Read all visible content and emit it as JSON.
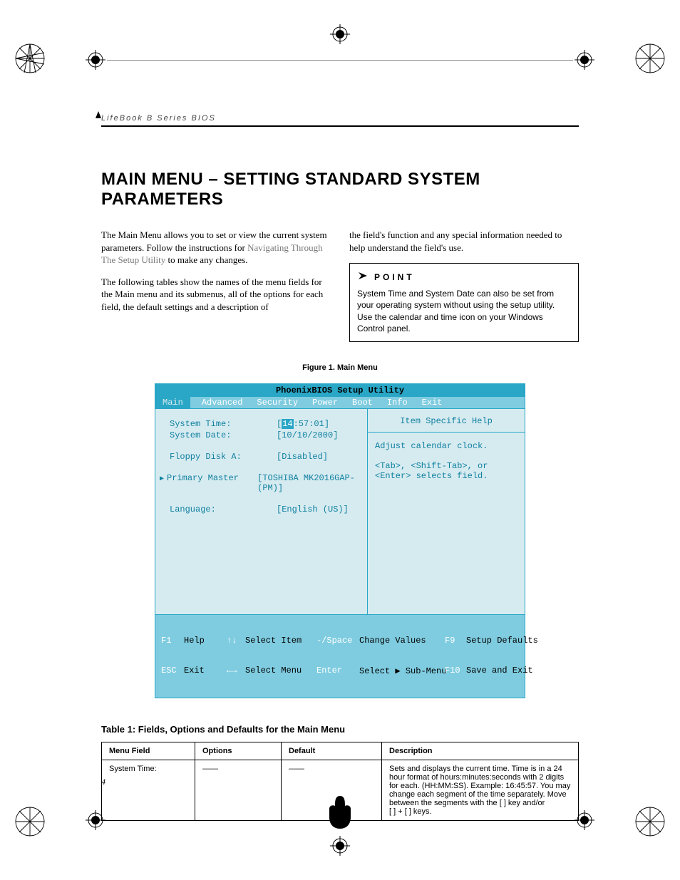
{
  "running_head": "LifeBook B Series BIOS",
  "page_title": "MAIN MENU – SETTING STANDARD SYSTEM PARAMETERS",
  "col1_p1a": "The Main Menu allows you to set or view the current system parameters. Follow the instructions for ",
  "col1_p1_xref": "Navigating Through The Setup Utility",
  "col1_p1b": " to make any changes.",
  "col1_p2": "The following tables show the names of the menu fields for the Main menu and its submenus, all of the options for each field, the default settings and a description of",
  "col2_p1": "the field's function and any special information needed to help understand the field's use.",
  "point_label": "POINT",
  "point_text": "System Time and System Date can also be set from your operating system without using the setup utility. Use the calendar and time icon on your Windows Control panel.",
  "figure_caption": "Figure 1.  Main Menu",
  "bios": {
    "title": "PhoenixBIOS Setup Utility",
    "tabs": [
      "Main",
      "Advanced",
      "Security",
      "Power",
      "Boot",
      "Info",
      "Exit"
    ],
    "fields": {
      "system_time_label": "System Time:",
      "system_time_value": "14",
      "system_time_rest": ":57:01]",
      "system_date_label": "System Date:",
      "system_date_value": "[10/10/2000]",
      "floppy_label": "Floppy Disk A:",
      "floppy_value": "[Disabled]",
      "primary_master_label": "Primary Master",
      "primary_master_value": "[TOSHIBA MK2016GAP-(PM)]",
      "language_label": "Language:",
      "language_value": "[English (US)]"
    },
    "help_title": "Item Specific Help",
    "help_line1": "Adjust calendar clock.",
    "help_line2": "<Tab>, <Shift-Tab>, or <Enter> selects field.",
    "footer": {
      "f1_key": "F1",
      "f1_label": "Help",
      "esc_key": "ESC",
      "esc_label": "Exit",
      "arrow_v_key": "↑↓",
      "arrow_v_label": "Select Item",
      "arrow_h_key": "←→",
      "arrow_h_label": "Select Menu",
      "change_key": "-/Space",
      "change_label": "Change Values",
      "enter_key": "Enter",
      "enter_label": "Select ▶ Sub-Menu",
      "f9_key": "F9",
      "f9_label": "Setup Defaults",
      "f10_key": "F10",
      "f10_label": "Save and Exit"
    }
  },
  "table_caption": "Table 1: Fields, Options and Defaults for the Main Menu",
  "table": {
    "headers": [
      "Menu Field",
      "Options",
      "Default",
      "Description"
    ],
    "row1": {
      "field": "System Time:",
      "options": "——",
      "default": "——",
      "desc": "Sets and displays the current time. Time is in a 24 hour format of hours:minutes:seconds with 2 digits for each. (HH:MM:SS). Example: 16:45:57. You may change each segment of the time separately. Move between the segments with the [    ] key and/or\n[    ] + [    ] keys."
    }
  },
  "page_number": "4"
}
